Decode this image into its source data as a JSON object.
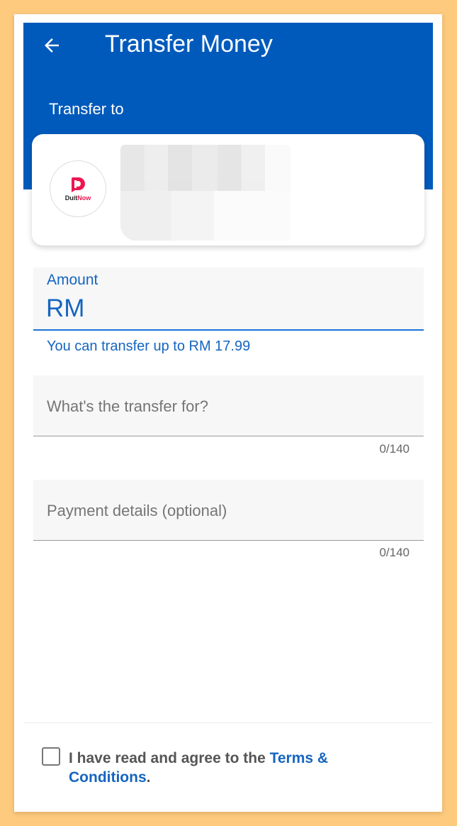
{
  "header": {
    "title": "Transfer Money",
    "back_icon": "arrow-left-icon",
    "color": "#005abb"
  },
  "recipient": {
    "section_label": "Transfer to",
    "logo_icon": "duitnow-logo",
    "logo_text_prefix": "Duit",
    "logo_text_suffix": "Now"
  },
  "amount": {
    "label": "Amount",
    "currency_prefix": "RM",
    "value": "",
    "hint": "You can transfer up to RM 17.99"
  },
  "purpose": {
    "placeholder": "What's the transfer for?",
    "counter": "0/140"
  },
  "payment_details": {
    "placeholder": "Payment details (optional)",
    "counter": "0/140"
  },
  "terms": {
    "text": "I have read and agree to the ",
    "link": "Terms & Conditions",
    "suffix": ".",
    "checked": false
  },
  "colors": {
    "accent": "#1565c0",
    "brand_pink": "#ed1652",
    "background": "#fdca7e"
  }
}
